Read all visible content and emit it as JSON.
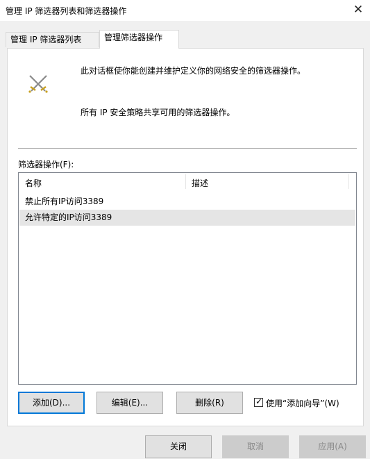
{
  "window": {
    "title": "管理 IP 筛选器列表和筛选器操作",
    "close_glyph": "✕"
  },
  "tabs": [
    {
      "label": "管理 IP 筛选器列表",
      "active": false
    },
    {
      "label": "管理筛选器操作",
      "active": true
    }
  ],
  "panel": {
    "icon": "crossed-swords-icon",
    "description_1": "此对话框使你能创建并维护定义你的网络安全的筛选器操作。",
    "description_2": "所有 IP 安全策略共享可用的筛选器操作。",
    "list_label": "筛选器操作(F):",
    "columns": {
      "name": "名称",
      "description": "描述"
    },
    "rows": [
      {
        "name": "禁止所有IP访问3389",
        "description": "",
        "selected": false
      },
      {
        "name": "允许特定的IP访问3389",
        "description": "",
        "selected": true
      }
    ],
    "buttons": {
      "add": "添加(D)...",
      "edit": "编辑(E)...",
      "delete": "删除(R)"
    },
    "wizard_checkbox": {
      "label": "使用“添加向导”(W)",
      "checked": true
    }
  },
  "footer": {
    "close": "关闭",
    "cancel": "取消",
    "apply": "应用(A)"
  },
  "colors": {
    "focus_border": "#0078d7",
    "selected_row": "#e5e5e5",
    "dialog_bg": "#f0f0f0"
  }
}
